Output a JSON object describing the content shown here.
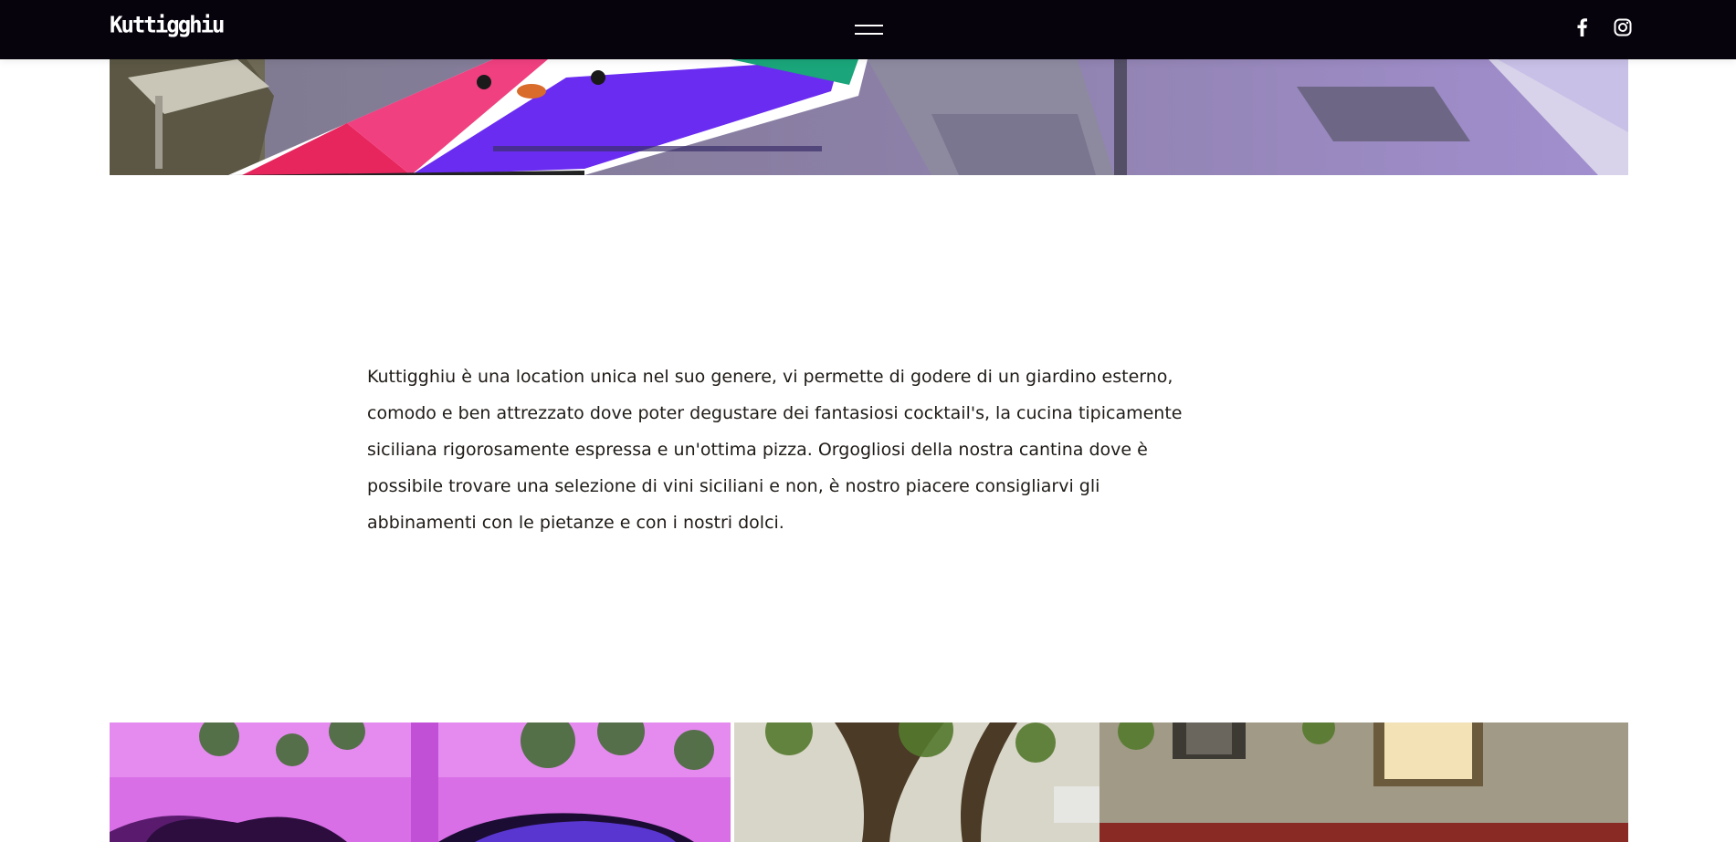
{
  "header": {
    "logo_text": "Kuttigghiu",
    "menu_icon": "hamburger-menu-icon",
    "social": [
      {
        "icon": "facebook-icon"
      },
      {
        "icon": "instagram-icon"
      }
    ]
  },
  "intro": {
    "text": "Kuttigghiu è una location unica nel suo genere, vi permette di godere di un giardino esterno, comodo e ben attrezzato dove poter degustare dei fantasiosi cocktail's, la cucina tipicamente siciliana rigorosamente espressa e un'ottima pizza. Orgogliosi della nostra cantina dove è possibile trovare una selezione di vini siciliani e non, è nostro piacere consigliarvi gli abbinamenti con le pietanze e con i nostri dolci."
  },
  "colors": {
    "header_bg": "#07030d",
    "text": "#1f1b17",
    "accent_magenta": "#e04bd8"
  }
}
